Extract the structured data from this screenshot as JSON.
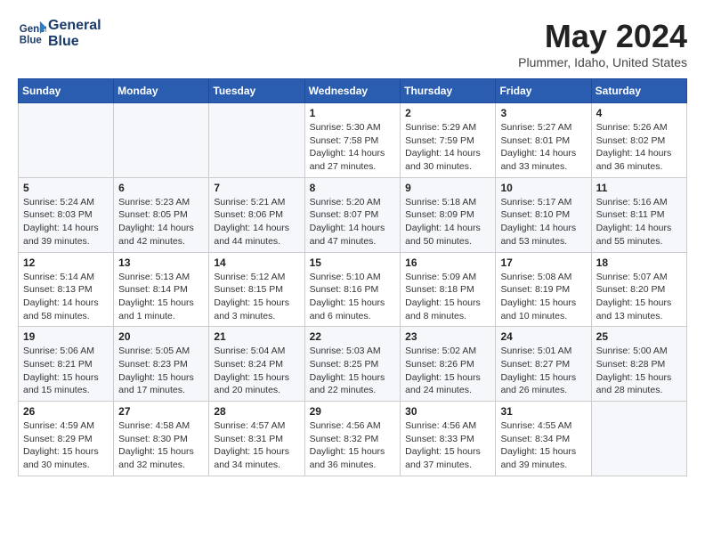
{
  "header": {
    "logo_line1": "General",
    "logo_line2": "Blue",
    "month_title": "May 2024",
    "location": "Plummer, Idaho, United States"
  },
  "weekdays": [
    "Sunday",
    "Monday",
    "Tuesday",
    "Wednesday",
    "Thursday",
    "Friday",
    "Saturday"
  ],
  "weeks": [
    [
      {
        "day": "",
        "info": ""
      },
      {
        "day": "",
        "info": ""
      },
      {
        "day": "",
        "info": ""
      },
      {
        "day": "1",
        "info": "Sunrise: 5:30 AM\nSunset: 7:58 PM\nDaylight: 14 hours\nand 27 minutes."
      },
      {
        "day": "2",
        "info": "Sunrise: 5:29 AM\nSunset: 7:59 PM\nDaylight: 14 hours\nand 30 minutes."
      },
      {
        "day": "3",
        "info": "Sunrise: 5:27 AM\nSunset: 8:01 PM\nDaylight: 14 hours\nand 33 minutes."
      },
      {
        "day": "4",
        "info": "Sunrise: 5:26 AM\nSunset: 8:02 PM\nDaylight: 14 hours\nand 36 minutes."
      }
    ],
    [
      {
        "day": "5",
        "info": "Sunrise: 5:24 AM\nSunset: 8:03 PM\nDaylight: 14 hours\nand 39 minutes."
      },
      {
        "day": "6",
        "info": "Sunrise: 5:23 AM\nSunset: 8:05 PM\nDaylight: 14 hours\nand 42 minutes."
      },
      {
        "day": "7",
        "info": "Sunrise: 5:21 AM\nSunset: 8:06 PM\nDaylight: 14 hours\nand 44 minutes."
      },
      {
        "day": "8",
        "info": "Sunrise: 5:20 AM\nSunset: 8:07 PM\nDaylight: 14 hours\nand 47 minutes."
      },
      {
        "day": "9",
        "info": "Sunrise: 5:18 AM\nSunset: 8:09 PM\nDaylight: 14 hours\nand 50 minutes."
      },
      {
        "day": "10",
        "info": "Sunrise: 5:17 AM\nSunset: 8:10 PM\nDaylight: 14 hours\nand 53 minutes."
      },
      {
        "day": "11",
        "info": "Sunrise: 5:16 AM\nSunset: 8:11 PM\nDaylight: 14 hours\nand 55 minutes."
      }
    ],
    [
      {
        "day": "12",
        "info": "Sunrise: 5:14 AM\nSunset: 8:13 PM\nDaylight: 14 hours\nand 58 minutes."
      },
      {
        "day": "13",
        "info": "Sunrise: 5:13 AM\nSunset: 8:14 PM\nDaylight: 15 hours\nand 1 minute."
      },
      {
        "day": "14",
        "info": "Sunrise: 5:12 AM\nSunset: 8:15 PM\nDaylight: 15 hours\nand 3 minutes."
      },
      {
        "day": "15",
        "info": "Sunrise: 5:10 AM\nSunset: 8:16 PM\nDaylight: 15 hours\nand 6 minutes."
      },
      {
        "day": "16",
        "info": "Sunrise: 5:09 AM\nSunset: 8:18 PM\nDaylight: 15 hours\nand 8 minutes."
      },
      {
        "day": "17",
        "info": "Sunrise: 5:08 AM\nSunset: 8:19 PM\nDaylight: 15 hours\nand 10 minutes."
      },
      {
        "day": "18",
        "info": "Sunrise: 5:07 AM\nSunset: 8:20 PM\nDaylight: 15 hours\nand 13 minutes."
      }
    ],
    [
      {
        "day": "19",
        "info": "Sunrise: 5:06 AM\nSunset: 8:21 PM\nDaylight: 15 hours\nand 15 minutes."
      },
      {
        "day": "20",
        "info": "Sunrise: 5:05 AM\nSunset: 8:23 PM\nDaylight: 15 hours\nand 17 minutes."
      },
      {
        "day": "21",
        "info": "Sunrise: 5:04 AM\nSunset: 8:24 PM\nDaylight: 15 hours\nand 20 minutes."
      },
      {
        "day": "22",
        "info": "Sunrise: 5:03 AM\nSunset: 8:25 PM\nDaylight: 15 hours\nand 22 minutes."
      },
      {
        "day": "23",
        "info": "Sunrise: 5:02 AM\nSunset: 8:26 PM\nDaylight: 15 hours\nand 24 minutes."
      },
      {
        "day": "24",
        "info": "Sunrise: 5:01 AM\nSunset: 8:27 PM\nDaylight: 15 hours\nand 26 minutes."
      },
      {
        "day": "25",
        "info": "Sunrise: 5:00 AM\nSunset: 8:28 PM\nDaylight: 15 hours\nand 28 minutes."
      }
    ],
    [
      {
        "day": "26",
        "info": "Sunrise: 4:59 AM\nSunset: 8:29 PM\nDaylight: 15 hours\nand 30 minutes."
      },
      {
        "day": "27",
        "info": "Sunrise: 4:58 AM\nSunset: 8:30 PM\nDaylight: 15 hours\nand 32 minutes."
      },
      {
        "day": "28",
        "info": "Sunrise: 4:57 AM\nSunset: 8:31 PM\nDaylight: 15 hours\nand 34 minutes."
      },
      {
        "day": "29",
        "info": "Sunrise: 4:56 AM\nSunset: 8:32 PM\nDaylight: 15 hours\nand 36 minutes."
      },
      {
        "day": "30",
        "info": "Sunrise: 4:56 AM\nSunset: 8:33 PM\nDaylight: 15 hours\nand 37 minutes."
      },
      {
        "day": "31",
        "info": "Sunrise: 4:55 AM\nSunset: 8:34 PM\nDaylight: 15 hours\nand 39 minutes."
      },
      {
        "day": "",
        "info": ""
      }
    ]
  ]
}
